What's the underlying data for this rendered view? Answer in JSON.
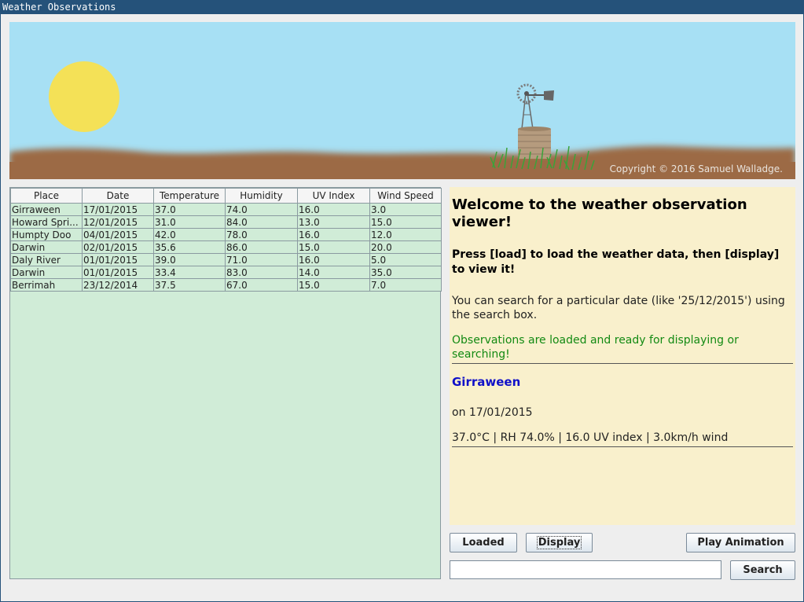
{
  "window": {
    "title": "Weather Observations"
  },
  "banner": {
    "copyright": "Copyright © 2016 Samuel Walladge."
  },
  "table": {
    "columns": [
      "Place",
      "Date",
      "Temperature",
      "Humidity",
      "UV Index",
      "Wind Speed"
    ],
    "rows": [
      [
        "Girraween",
        "17/01/2015",
        "37.0",
        "74.0",
        "16.0",
        "3.0"
      ],
      [
        "Howard Spri...",
        "12/01/2015",
        "31.0",
        "84.0",
        "13.0",
        "15.0"
      ],
      [
        "Humpty Doo",
        "04/01/2015",
        "42.0",
        "78.0",
        "16.0",
        "12.0"
      ],
      [
        "Darwin",
        "02/01/2015",
        "35.6",
        "86.0",
        "15.0",
        "20.0"
      ],
      [
        "Daly River",
        "01/01/2015",
        "39.0",
        "71.0",
        "16.0",
        "5.0"
      ],
      [
        "Darwin",
        "01/01/2015",
        "33.4",
        "83.0",
        "14.0",
        "35.0"
      ],
      [
        "Berrimah",
        "23/12/2014",
        "37.5",
        "67.0",
        "15.0",
        "7.0"
      ]
    ]
  },
  "info": {
    "welcome": "Welcome to the weather observation viewer!",
    "instructions": "Press [load] to load the weather data, then [display] to view it!",
    "search_hint": "You can search for a particular date (like '25/12/2015') using the search box.",
    "status": "Observations are loaded and ready for displaying or searching!",
    "selected_place": "Girraween",
    "selected_date": "on 17/01/2015",
    "selected_details": "37.0°C | RH 74.0% | 16.0 UV index | 3.0km/h wind"
  },
  "buttons": {
    "loaded": "Loaded",
    "display": "Display",
    "play": "Play Animation",
    "search": "Search"
  },
  "search": {
    "value": ""
  },
  "colors": {
    "titlebar": "#25527a",
    "sky": "#a6e0f4",
    "sun": "#f4e157",
    "ground": "#9c6a45",
    "table_bg": "#d0ecd7",
    "info_bg": "#f9f0cc",
    "status_text": "#138a13",
    "place_text": "#1010c8"
  }
}
